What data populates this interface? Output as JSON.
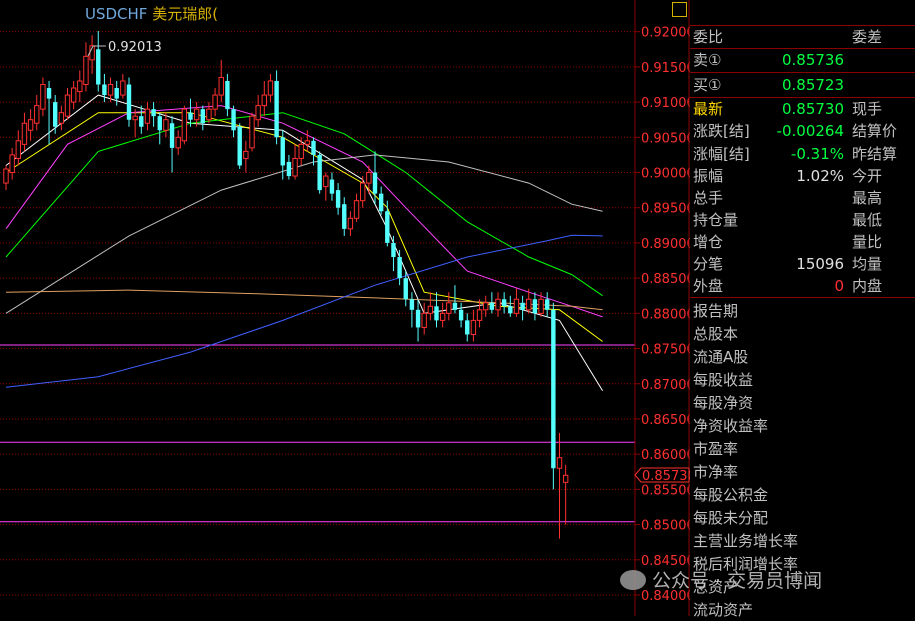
{
  "header": {
    "symbol": "USDCHF",
    "name": "美元瑞郎("
  },
  "quote": {
    "wei_bi": "委比",
    "wei_cha": "委差",
    "sell_label": "卖①",
    "sell_value": "0.85736",
    "buy_label": "买①",
    "buy_value": "0.85723",
    "latest_label": "最新",
    "latest_value": "0.85730",
    "xianshou": "现手",
    "change_label": "涨跌[结]",
    "change_value": "-0.00264",
    "settle_label": "结算价",
    "pct_label": "涨幅[结]",
    "pct_value": "-0.31%",
    "prev_settle_label": "昨结算",
    "amp_label": "振幅",
    "amp_value": "1.02%",
    "open_label": "今开",
    "volume_label": "总手",
    "high_label": "最高",
    "oi_label": "持仓量",
    "low_label": "最低",
    "oi_add_label": "增仓",
    "vol_ratio_label": "量比",
    "tick_label": "分笔",
    "tick_value": "15096",
    "avg_label": "均量",
    "outer_label": "外盘",
    "outer_value": "0",
    "inner_label": "内盘"
  },
  "fundamentals": [
    "报告期",
    "总股本",
    "流通A股",
    "每股收益",
    "每股净资",
    "净资收益率",
    "市盈率",
    "市净率",
    "每股公积金",
    "每股未分配",
    "主营业务增长率",
    "税后利润增长率",
    "总资产",
    "流动资产"
  ],
  "watermark": "公众号 · 交易员博闻",
  "colors": {
    "up": "#ff3030",
    "down": "#54ffff",
    "grid": "#8b0000",
    "axis_text": "#ff3030",
    "price_tag": "#ff3030"
  },
  "chart_data": {
    "type": "candlestick",
    "title": "USDCHF",
    "ylim": [
      0.84,
      0.9245
    ],
    "y_ticks": [
      0.92,
      0.915,
      0.91,
      0.905,
      0.9,
      0.895,
      0.89,
      0.885,
      0.88,
      0.875,
      0.87,
      0.865,
      0.86,
      0.855,
      0.85,
      0.845,
      0.84
    ],
    "y_tick_labels": [
      "0.92000",
      "0.91500",
      "0.91000",
      "0.90500",
      "0.90000",
      "0.89500",
      "0.89000",
      "0.88500",
      "0.88000",
      "0.87500",
      "0.87000",
      "0.86500",
      "0.86000",
      "0.85500",
      "0.85000",
      "0.84500",
      "0.84000"
    ],
    "current_price": "0.85730",
    "max_annotation": "0.92013",
    "horizontal_lines": [
      0.8755,
      0.8617,
      0.8504
    ],
    "candles": [
      [
        0.8985,
        0.9005,
        0.8975,
        0.901
      ],
      [
        0.9,
        0.9025,
        0.899,
        0.9035
      ],
      [
        0.902,
        0.9045,
        0.901,
        0.906
      ],
      [
        0.904,
        0.907,
        0.903,
        0.9085
      ],
      [
        0.906,
        0.9075,
        0.9045,
        0.909
      ],
      [
        0.907,
        0.9095,
        0.906,
        0.911
      ],
      [
        0.909,
        0.9125,
        0.908,
        0.9135
      ],
      [
        0.912,
        0.9105,
        0.904,
        0.913
      ],
      [
        0.91,
        0.9065,
        0.9055,
        0.911
      ],
      [
        0.907,
        0.9085,
        0.906,
        0.9095
      ],
      [
        0.908,
        0.911,
        0.9075,
        0.912
      ],
      [
        0.91,
        0.912,
        0.909,
        0.913
      ],
      [
        0.9115,
        0.913,
        0.91,
        0.9145
      ],
      [
        0.9125,
        0.9165,
        0.9115,
        0.9185
      ],
      [
        0.916,
        0.918,
        0.914,
        0.9195
      ],
      [
        0.9175,
        0.9125,
        0.9115,
        0.9201
      ],
      [
        0.9125,
        0.911,
        0.91,
        0.914
      ],
      [
        0.911,
        0.9125,
        0.91,
        0.9135
      ],
      [
        0.912,
        0.9105,
        0.9095,
        0.913
      ],
      [
        0.911,
        0.913,
        0.9105,
        0.914
      ],
      [
        0.9125,
        0.9075,
        0.9065,
        0.9135
      ],
      [
        0.9075,
        0.908,
        0.905,
        0.909
      ],
      [
        0.908,
        0.9065,
        0.9055,
        0.9095
      ],
      [
        0.907,
        0.909,
        0.906,
        0.91
      ],
      [
        0.909,
        0.908,
        0.9065,
        0.91
      ],
      [
        0.908,
        0.906,
        0.904,
        0.9085
      ],
      [
        0.906,
        0.9075,
        0.905,
        0.9085
      ],
      [
        0.907,
        0.9035,
        0.9,
        0.908
      ],
      [
        0.9035,
        0.905,
        0.9025,
        0.906
      ],
      [
        0.9045,
        0.909,
        0.904,
        0.9095
      ],
      [
        0.9085,
        0.9075,
        0.9065,
        0.9105
      ],
      [
        0.9075,
        0.909,
        0.9065,
        0.91
      ],
      [
        0.909,
        0.907,
        0.906,
        0.9095
      ],
      [
        0.9075,
        0.909,
        0.907,
        0.91
      ],
      [
        0.909,
        0.911,
        0.908,
        0.912
      ],
      [
        0.911,
        0.9135,
        0.91,
        0.916
      ],
      [
        0.913,
        0.909,
        0.908,
        0.914
      ],
      [
        0.909,
        0.906,
        0.905,
        0.9095
      ],
      [
        0.9065,
        0.901,
        0.9005,
        0.907
      ],
      [
        0.902,
        0.903,
        0.9,
        0.9045
      ],
      [
        0.9035,
        0.908,
        0.903,
        0.9085
      ],
      [
        0.9075,
        0.9095,
        0.9065,
        0.911
      ],
      [
        0.9095,
        0.911,
        0.908,
        0.913
      ],
      [
        0.911,
        0.913,
        0.91,
        0.914
      ],
      [
        0.913,
        0.905,
        0.904,
        0.9145
      ],
      [
        0.905,
        0.901,
        0.899,
        0.906
      ],
      [
        0.9015,
        0.8995,
        0.899,
        0.9025
      ],
      [
        0.8995,
        0.902,
        0.899,
        0.904
      ],
      [
        0.902,
        0.904,
        0.901,
        0.905
      ],
      [
        0.904,
        0.9045,
        0.903,
        0.906
      ],
      [
        0.9045,
        0.9025,
        0.901,
        0.905
      ],
      [
        0.9025,
        0.8975,
        0.897,
        0.903
      ],
      [
        0.898,
        0.8995,
        0.896,
        0.9
      ],
      [
        0.899,
        0.897,
        0.896,
        0.9
      ],
      [
        0.8975,
        0.895,
        0.894,
        0.8985
      ],
      [
        0.8955,
        0.892,
        0.891,
        0.8965
      ],
      [
        0.892,
        0.8935,
        0.891,
        0.8945
      ],
      [
        0.8935,
        0.896,
        0.893,
        0.897
      ],
      [
        0.896,
        0.8985,
        0.895,
        0.8995
      ],
      [
        0.8985,
        0.9,
        0.897,
        0.901
      ],
      [
        0.9,
        0.897,
        0.8955,
        0.903
      ],
      [
        0.897,
        0.8945,
        0.894,
        0.898
      ],
      [
        0.8945,
        0.89,
        0.8895,
        0.896
      ],
      [
        0.89,
        0.888,
        0.886,
        0.891
      ],
      [
        0.888,
        0.885,
        0.884,
        0.889
      ],
      [
        0.885,
        0.882,
        0.881,
        0.886
      ],
      [
        0.882,
        0.8805,
        0.878,
        0.883
      ],
      [
        0.8805,
        0.878,
        0.876,
        0.882
      ],
      [
        0.878,
        0.88,
        0.877,
        0.8815
      ],
      [
        0.88,
        0.881,
        0.879,
        0.883
      ],
      [
        0.881,
        0.879,
        0.878,
        0.883
      ],
      [
        0.879,
        0.88,
        0.878,
        0.8815
      ],
      [
        0.88,
        0.8815,
        0.879,
        0.883
      ],
      [
        0.8815,
        0.8805,
        0.88,
        0.884
      ],
      [
        0.8805,
        0.879,
        0.878,
        0.8815
      ],
      [
        0.879,
        0.877,
        0.876,
        0.88
      ],
      [
        0.877,
        0.879,
        0.876,
        0.8805
      ],
      [
        0.879,
        0.8805,
        0.878,
        0.882
      ],
      [
        0.8805,
        0.8815,
        0.8795,
        0.8825
      ],
      [
        0.8815,
        0.8805,
        0.88,
        0.883
      ],
      [
        0.8805,
        0.882,
        0.8795,
        0.883
      ],
      [
        0.882,
        0.881,
        0.88,
        0.883
      ],
      [
        0.881,
        0.88,
        0.8795,
        0.8825
      ],
      [
        0.88,
        0.882,
        0.8795,
        0.8835
      ],
      [
        0.8815,
        0.8805,
        0.879,
        0.8825
      ],
      [
        0.8805,
        0.882,
        0.88,
        0.8835
      ],
      [
        0.882,
        0.88,
        0.879,
        0.883
      ],
      [
        0.88,
        0.882,
        0.8795,
        0.883
      ],
      [
        0.882,
        0.8805,
        0.8795,
        0.883
      ],
      [
        0.8805,
        0.858,
        0.855,
        0.8815
      ],
      [
        0.858,
        0.8595,
        0.848,
        0.863
      ],
      [
        0.856,
        0.857,
        0.85,
        0.8585
      ]
    ],
    "ma_lines": [
      {
        "color": "#ffffff",
        "points": [
          [
            0,
            0.901
          ],
          [
            15,
            0.911
          ],
          [
            30,
            0.907
          ],
          [
            45,
            0.906
          ],
          [
            58,
            0.899
          ],
          [
            62,
            0.892
          ],
          [
            68,
            0.88
          ],
          [
            80,
            0.8815
          ],
          [
            90,
            0.879
          ],
          [
            97,
            0.869
          ]
        ]
      },
      {
        "color": "#ffff00",
        "points": [
          [
            0,
            0.9
          ],
          [
            15,
            0.9085
          ],
          [
            30,
            0.9085
          ],
          [
            45,
            0.905
          ],
          [
            58,
            0.8985
          ],
          [
            62,
            0.895
          ],
          [
            68,
            0.883
          ],
          [
            80,
            0.881
          ],
          [
            90,
            0.8805
          ],
          [
            97,
            0.876
          ]
        ]
      },
      {
        "color": "#ff40ff",
        "points": [
          [
            0,
            0.892
          ],
          [
            10,
            0.904
          ],
          [
            20,
            0.9085
          ],
          [
            35,
            0.9095
          ],
          [
            45,
            0.907
          ],
          [
            58,
            0.9015
          ],
          [
            65,
            0.895
          ],
          [
            75,
            0.886
          ],
          [
            85,
            0.883
          ],
          [
            92,
            0.881
          ],
          [
            97,
            0.8795
          ]
        ]
      },
      {
        "color": "#00ff00",
        "points": [
          [
            0,
            0.888
          ],
          [
            15,
            0.903
          ],
          [
            30,
            0.907
          ],
          [
            45,
            0.9085
          ],
          [
            55,
            0.9055
          ],
          [
            65,
            0.9
          ],
          [
            75,
            0.893
          ],
          [
            85,
            0.888
          ],
          [
            92,
            0.8855
          ],
          [
            97,
            0.8825
          ]
        ]
      },
      {
        "color": "#c0c0c0",
        "points": [
          [
            0,
            0.88
          ],
          [
            20,
            0.891
          ],
          [
            35,
            0.8975
          ],
          [
            50,
            0.9015
          ],
          [
            60,
            0.9025
          ],
          [
            72,
            0.9015
          ],
          [
            85,
            0.8985
          ],
          [
            92,
            0.8955
          ],
          [
            97,
            0.8945
          ]
        ]
      },
      {
        "color": "#e0a060",
        "points": [
          [
            0,
            0.883
          ],
          [
            20,
            0.8833
          ],
          [
            40,
            0.8828
          ],
          [
            60,
            0.8822
          ],
          [
            80,
            0.8815
          ],
          [
            92,
            0.881
          ],
          [
            97,
            0.8805
          ]
        ]
      },
      {
        "color": "#4060ff",
        "points": [
          [
            0,
            0.8695
          ],
          [
            15,
            0.871
          ],
          [
            30,
            0.8745
          ],
          [
            45,
            0.879
          ],
          [
            60,
            0.884
          ],
          [
            75,
            0.888
          ],
          [
            88,
            0.8903
          ],
          [
            92,
            0.8911
          ],
          [
            97,
            0.891
          ]
        ]
      }
    ]
  }
}
